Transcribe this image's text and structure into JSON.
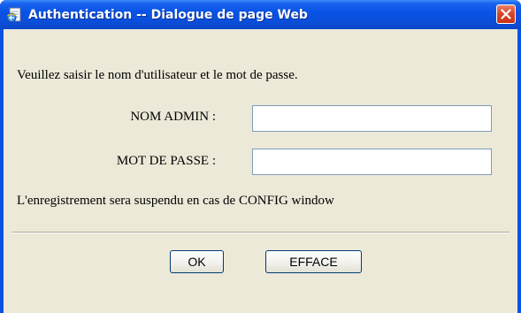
{
  "window": {
    "title": "Authentication -- Dialogue de page Web",
    "icon": "ie-page-icon",
    "close_icon": "close-icon"
  },
  "dialog": {
    "instructions": "Veuillez saisir le nom d'utilisateur et le mot de passe.",
    "username_label": "NOM ADMIN :",
    "username_value": "",
    "password_label": "MOT DE PASSE :",
    "password_value": "",
    "notice": "L'enregistrement sera suspendu en cas de CONFIG window"
  },
  "buttons": {
    "ok_label": "OK",
    "clear_label": "EFFACE"
  },
  "colors": {
    "titlebar": "#0a53e6",
    "client_background": "#ece9d8",
    "close_button": "#d9482b"
  }
}
